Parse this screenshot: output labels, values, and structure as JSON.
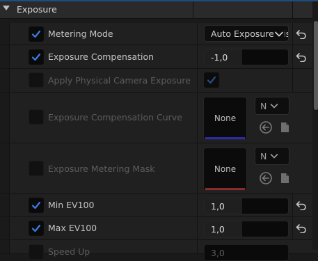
{
  "section": {
    "title": "Exposure"
  },
  "rows": {
    "metering_mode": {
      "label": "Metering Mode",
      "value": "Auto Exposure Histogram"
    },
    "exposure_compensation": {
      "label": "Exposure Compensation",
      "value": "-1,0",
      "fill": 0.45
    },
    "apply_physical": {
      "label": "Apply Physical Camera Exposure"
    },
    "comp_curve": {
      "label": "Exposure Compensation Curve",
      "asset": "None",
      "dd_value": "N",
      "bar_color": "#2b2ba8"
    },
    "metering_mask": {
      "label": "Exposure Metering Mask",
      "asset": "None",
      "dd_value": "N",
      "bar_color": "#8a2a2a"
    },
    "min_ev": {
      "label": "Min EV100",
      "value": "1,0",
      "fill": 0.45
    },
    "max_ev": {
      "label": "Max EV100",
      "value": "1,0",
      "fill": 0.45
    },
    "speed_up": {
      "label": "Speed Up",
      "value": "3,0"
    }
  },
  "colors": {
    "accent": "#1c4f80",
    "checkmark": "#3d7ee6",
    "checkmark_disabled": "#2a4f80"
  }
}
